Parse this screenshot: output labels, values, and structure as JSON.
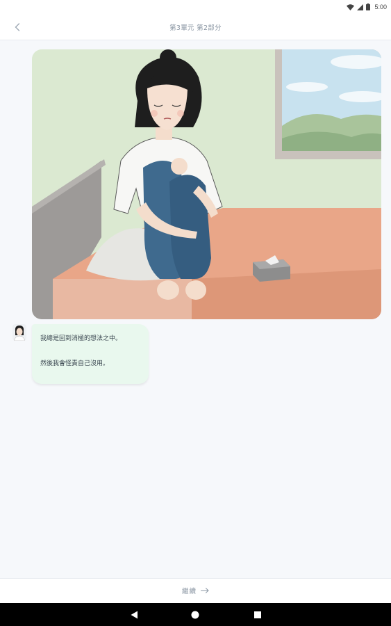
{
  "status_bar": {
    "time": "5:00",
    "icons": [
      "wifi-icon",
      "signal-icon",
      "battery-icon"
    ]
  },
  "header": {
    "title": "第3單元 第2部分",
    "back_icon": "chevron-left-icon"
  },
  "illustration": {
    "subject": "woman-sitting-on-bed-hugging-knees"
  },
  "chat": {
    "line1": "我總是回到消極的想法之中。",
    "line2": "然後我會怪責自己沒用。"
  },
  "footer": {
    "continue_label": "繼續",
    "arrow_icon": "arrow-right-icon"
  },
  "navigation": {
    "buttons": [
      "back-triangle-icon",
      "home-circle-icon",
      "recents-square-icon"
    ]
  },
  "colors": {
    "bubble": "#e9f8ee",
    "wall": "#dbe9d1",
    "bed": "#e9a688",
    "accent_text": "#8a96a3"
  }
}
